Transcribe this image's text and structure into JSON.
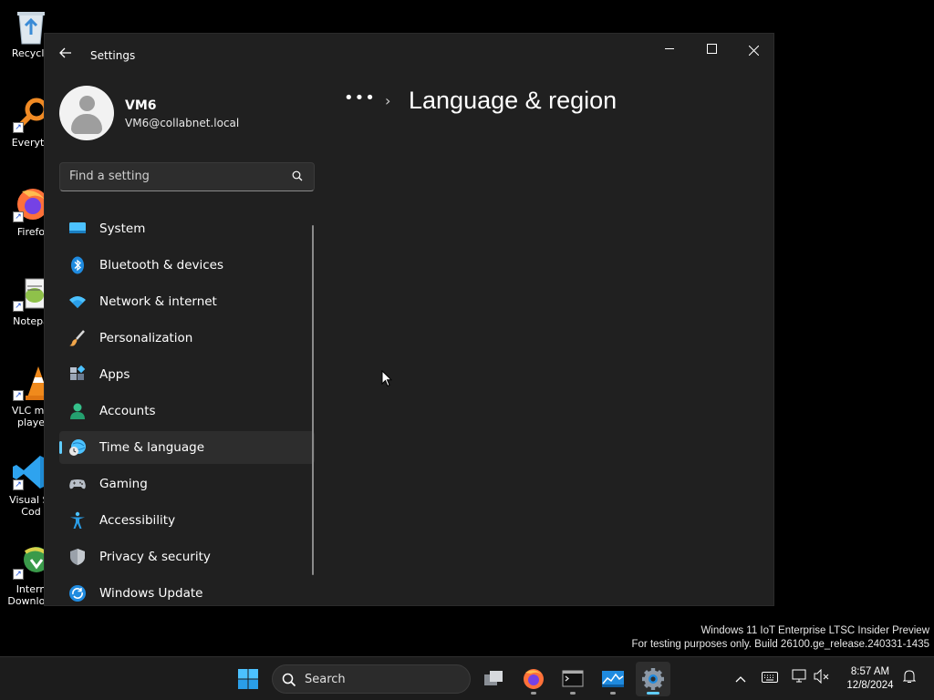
{
  "desktop": {
    "icons": [
      {
        "label": "Recycle",
        "name": "recycle-bin"
      },
      {
        "label": "Everyth",
        "name": "everything"
      },
      {
        "label": "Firefo",
        "name": "firefox"
      },
      {
        "label": "Notepa",
        "name": "notepad"
      },
      {
        "label": "VLC me\nplaye",
        "name": "vlc"
      },
      {
        "label": "Visual St\nCod",
        "name": "vscode"
      },
      {
        "label": "Intern\nDownlo...",
        "name": "idm"
      }
    ]
  },
  "window": {
    "app_title": "Settings",
    "controls": {
      "minimize": "—",
      "maximize": "☐",
      "close": "✕"
    }
  },
  "profile": {
    "name": "VM6",
    "email": "VM6@collabnet.local"
  },
  "search": {
    "placeholder": "Find a setting"
  },
  "nav": {
    "items": [
      {
        "label": "System",
        "icon": "system-icon"
      },
      {
        "label": "Bluetooth & devices",
        "icon": "bluetooth-icon"
      },
      {
        "label": "Network & internet",
        "icon": "wifi-icon"
      },
      {
        "label": "Personalization",
        "icon": "brush-icon"
      },
      {
        "label": "Apps",
        "icon": "apps-icon"
      },
      {
        "label": "Accounts",
        "icon": "accounts-icon"
      },
      {
        "label": "Time & language",
        "icon": "time-language-icon",
        "active": true
      },
      {
        "label": "Gaming",
        "icon": "gamepad-icon"
      },
      {
        "label": "Accessibility",
        "icon": "accessibility-icon"
      },
      {
        "label": "Privacy & security",
        "icon": "shield-icon"
      },
      {
        "label": "Windows Update",
        "icon": "update-icon"
      }
    ]
  },
  "breadcrumb": {
    "more": "•••",
    "separator": "›",
    "title": "Language & region"
  },
  "watermark": {
    "line1": "Windows 11 IoT Enterprise LTSC Insider Preview",
    "line2": "For testing purposes only. Build 26100.ge_release.240331-1435"
  },
  "taskbar": {
    "search_label": "Search",
    "clock": {
      "time": "8:57 AM",
      "date": "12/8/2024"
    }
  },
  "colors": {
    "accent": "#60cdff",
    "window_bg": "#202020",
    "taskbar_bg": "#1c1c1c"
  }
}
